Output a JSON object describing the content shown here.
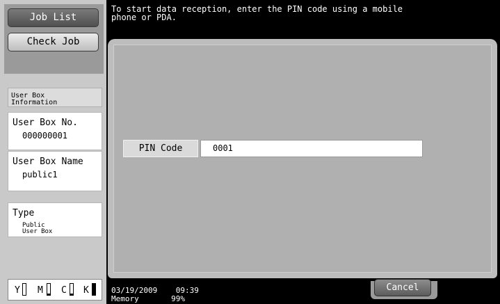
{
  "sidebar": {
    "job_list_label": "Job List",
    "check_job_label": "Check Job",
    "info_header": "User Box\nInformation",
    "box_no_title": "User Box No.",
    "box_no_value": "000000001",
    "box_name_title": "User Box Name",
    "box_name_value": "public1",
    "type_title": "Type",
    "type_value": "Public\nUser Box"
  },
  "toner": [
    {
      "label": "Y",
      "level": 0
    },
    {
      "label": "M",
      "level": 0.1
    },
    {
      "label": "C",
      "level": 0.1
    },
    {
      "label": "K",
      "level": 1.0
    }
  ],
  "header": {
    "message": "To start data reception, enter the PIN code using a mobile\nphone or PDA."
  },
  "form": {
    "pin_label": "PIN Code",
    "pin_value": "0001"
  },
  "status": {
    "date": "03/19/2009",
    "time": "09:39",
    "memory_label": "Memory",
    "memory_value": "99%"
  },
  "footer": {
    "cancel_label": "Cancel"
  },
  "colors": {
    "background_panel": "#bdbdbd",
    "bar_black": "#000000"
  }
}
